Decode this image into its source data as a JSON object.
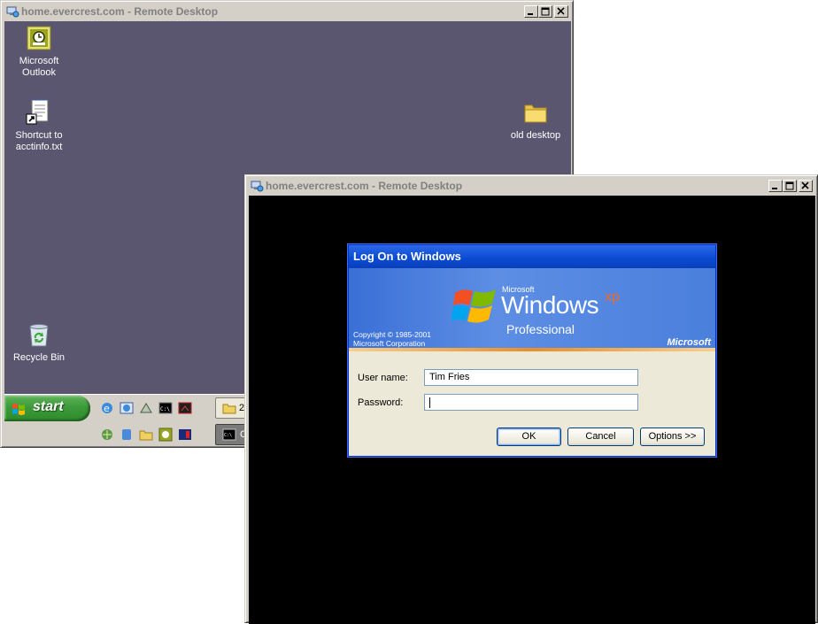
{
  "window1": {
    "title": "home.evercrest.com - Remote Desktop",
    "desktop_icons": [
      {
        "label_line1": "Microsoft",
        "label_line2": "Outlook",
        "icon": "outlook-icon"
      },
      {
        "label_line1": "Shortcut to",
        "label_line2": "acctinfo.txt",
        "icon": "text-file-shortcut-icon"
      },
      {
        "label_line1": "old desktop",
        "label_line2": "",
        "icon": "folder-icon"
      },
      {
        "label_line1": "Recycle Bin",
        "label_line2": "",
        "icon": "recycle-bin-icon"
      }
    ],
    "taskbar": {
      "start_label": "start",
      "task1_label": "2",
      "task2_label": "C"
    }
  },
  "window2": {
    "title": "home.evercrest.com - Remote Desktop"
  },
  "logon": {
    "title": "Log On to Windows",
    "banner": {
      "ms_small": "Microsoft",
      "windows": "Windows",
      "xp": "xp",
      "edition": "Professional",
      "copyright1": "Copyright © 1985-2001",
      "copyright2": "Microsoft Corporation",
      "microsoft": "Microsoft"
    },
    "username_label": "User name:",
    "username_value": "Tim Fries",
    "password_label": "Password:",
    "password_value": "",
    "ok_label": "OK",
    "cancel_label": "Cancel",
    "options_label": "Options >>"
  }
}
